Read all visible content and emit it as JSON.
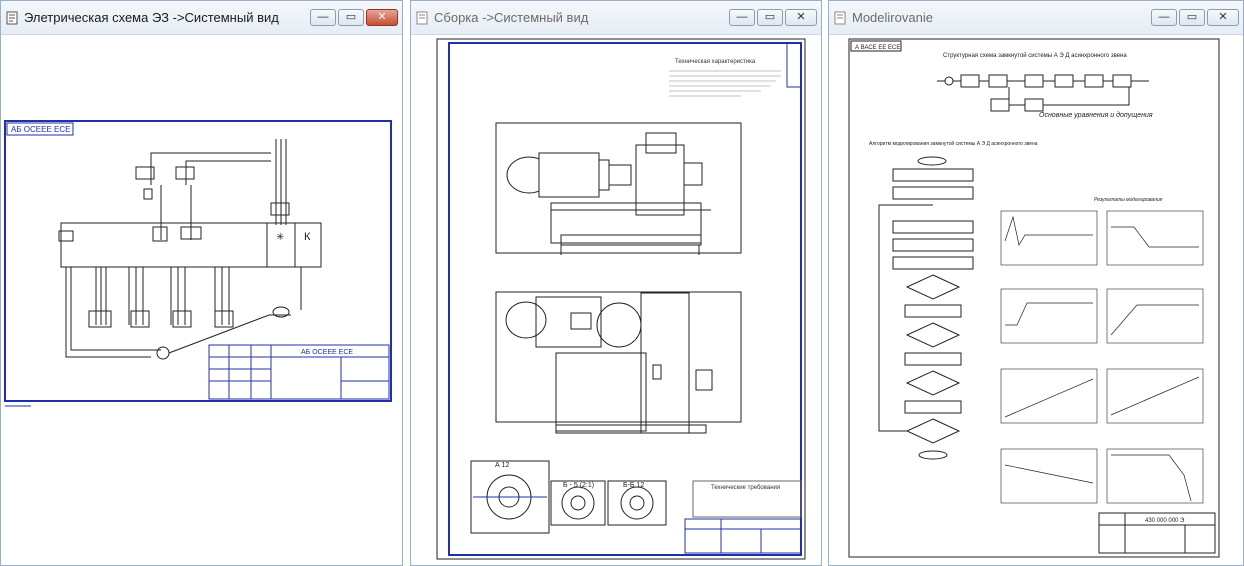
{
  "windows": [
    {
      "id": "electrical",
      "title": "Элетрическая схема ЭЗ ->Системный вид",
      "active": true,
      "stamp": "АБ ОСЕЕЕ ЕСЕ",
      "block_label": "К",
      "controls": {
        "minimize": "—",
        "maximize": "▭",
        "close": "✕"
      }
    },
    {
      "id": "assembly",
      "title": "Сборка ->Системный вид",
      "active": false,
      "notes_title": "Техническая характеристика",
      "tech_title": "Технические требования",
      "section_labels": [
        "А 12",
        "Б - 5 (2:1)",
        "Б-Б 12"
      ],
      "controls": {
        "minimize": "—",
        "maximize": "▭",
        "close": "✕"
      }
    },
    {
      "id": "modelirovanie",
      "title": "Modelirovanie",
      "active": false,
      "stamp": "А ВАСЕ ЕЕ ЕСЕ",
      "top_caption": "Структурная схема замкнутой системы А Э Д асинхронного звена",
      "eq_title": "Основные уравнения и допущения",
      "algo_title": "Алгоритм моделирования замкнутой системы А Э Д асинхронного звена",
      "results_title": "Результаты моделирования",
      "title_block_code": "430 000 000 Э",
      "controls": {
        "minimize": "—",
        "maximize": "▭",
        "close": "✕"
      }
    }
  ]
}
